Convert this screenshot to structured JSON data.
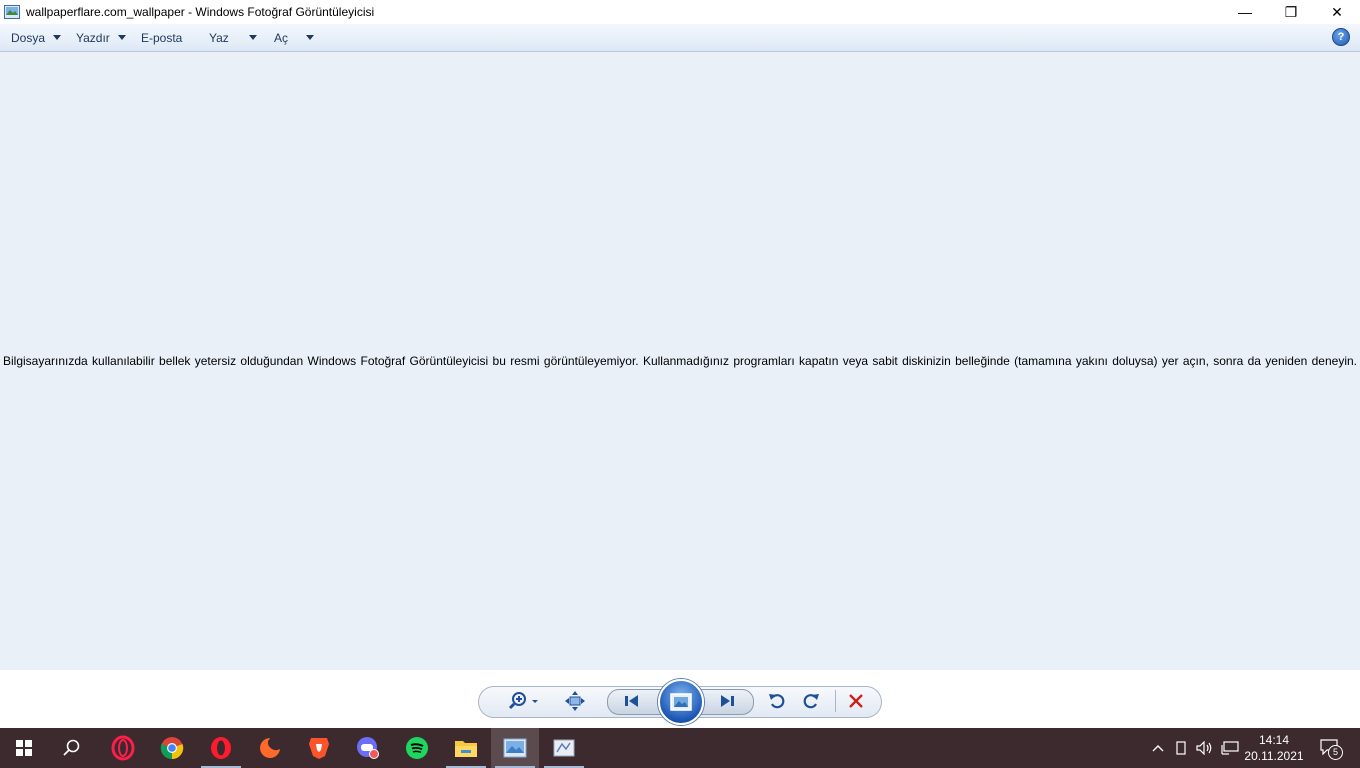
{
  "window": {
    "title": "wallpaperflare.com_wallpaper - Windows Fotoğraf Görüntüleyicisi",
    "minimize_glyph": "—",
    "restore_glyph": "❐",
    "close_glyph": "✕"
  },
  "menu": {
    "items": [
      {
        "label": "Dosya",
        "dropdown": true
      },
      {
        "label": "Yazdır",
        "dropdown": true
      },
      {
        "label": "E-posta",
        "dropdown": false
      },
      {
        "label": "Yaz",
        "dropdown": true
      },
      {
        "label": "Aç",
        "dropdown": true
      }
    ],
    "help_glyph": "?"
  },
  "viewer": {
    "message": "Bilgisayarınızda kullanılabilir bellek yetersiz olduğundan Windows Fotoğraf Görüntüleyicisi bu resmi görüntüleyemiyor. Kullanmadığınız programları kapatın veya sabit diskinizin belleğinde (tamamına yakını doluysa) yer açın, sonra da yeniden deneyin.",
    "background_color": "#eaf0f8"
  },
  "controls": {
    "icons": [
      "zoom-icon",
      "fit-window-icon",
      "previous-icon",
      "slideshow-icon",
      "next-icon",
      "rotate-left-icon",
      "rotate-right-icon",
      "delete-icon"
    ]
  },
  "taskbar": {
    "apps": [
      "start-icon",
      "search-icon",
      "opera-gx-icon",
      "chrome-icon",
      "opera-icon",
      "firefox-icon",
      "brave-icon",
      "chat-app-icon",
      "spotify-icon",
      "file-explorer-icon",
      "photo-viewer-icon",
      "paint-icon"
    ],
    "clock_time": "14:14",
    "clock_date": "20.11.2021",
    "notification_count": "5"
  }
}
